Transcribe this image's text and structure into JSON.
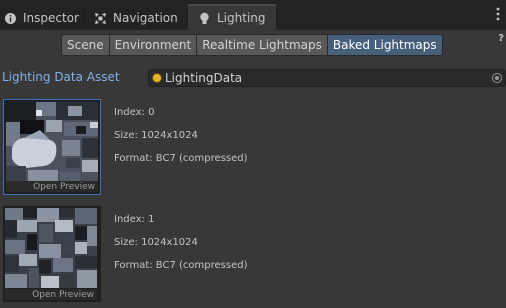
{
  "tabs": [
    {
      "label": "Inspector",
      "icon": "info-icon"
    },
    {
      "label": "Navigation",
      "icon": "navigation-icon"
    },
    {
      "label": "Lighting",
      "icon": "lightbulb-icon",
      "active": true
    }
  ],
  "modes": [
    {
      "label": "Scene",
      "selected": false
    },
    {
      "label": "Environment",
      "selected": false
    },
    {
      "label": "Realtime Lightmaps",
      "selected": false
    },
    {
      "label": "Baked Lightmaps",
      "selected": true
    }
  ],
  "help_label": "?",
  "lighting_data_asset": {
    "label": "Lighting Data Asset",
    "value": "LightingData"
  },
  "lightmaps": [
    {
      "index": "Index: 0",
      "size": "Size: 1024x1024",
      "format": "Format: BC7 (compressed)",
      "open_preview": "Open Preview",
      "selected": true
    },
    {
      "index": "Index: 1",
      "size": "Size: 1024x1024",
      "format": "Format: BC7 (compressed)",
      "open_preview": "Open Preview",
      "selected": false
    }
  ],
  "colors": {
    "accent": "#46607c",
    "label_blue": "#7eb3ea",
    "selection_border": "#3d6fb8",
    "background": "#383838"
  }
}
